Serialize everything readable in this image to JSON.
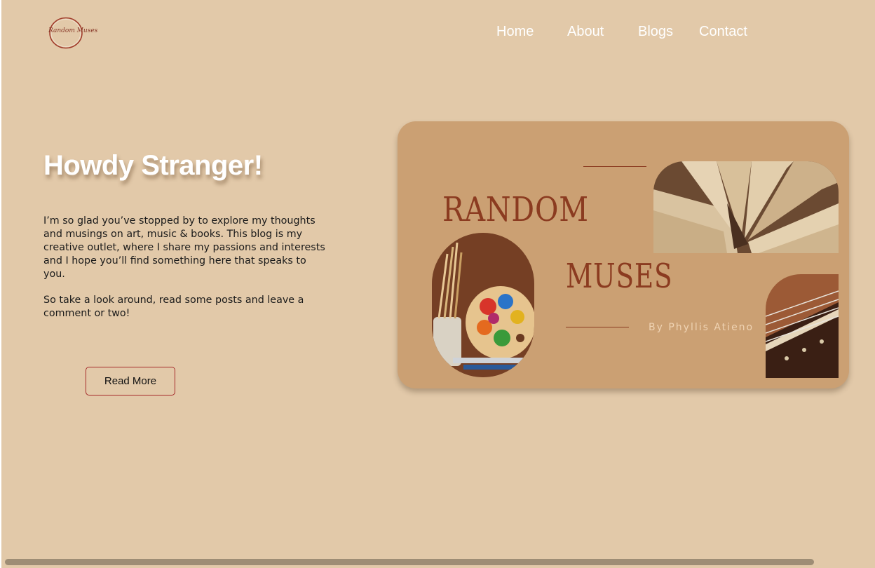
{
  "logo": {
    "text": "Random Muses"
  },
  "nav": {
    "items": [
      "Home",
      "About",
      "Blogs",
      "Contact"
    ]
  },
  "hero": {
    "title": "Howdy Stranger!",
    "paragraph_1": "I’m so glad you’ve stopped by to explore my thoughts and musings on art, music & books. This blog is my creative outlet, where I share my passions and interests and I hope you’ll find something here that speaks to you.",
    "paragraph_2": "So take a look around, read some posts and leave a comment or two!",
    "button_label": "Read More"
  },
  "banner": {
    "word_1": "RANDOM",
    "word_2": "MUSES",
    "byline": "By Phyllis Atieno"
  },
  "colors": {
    "background": "#e2c9a9",
    "banner": "#cba073",
    "accent": "#8b3b20",
    "button_border": "#a52a2a"
  },
  "icons": [
    "random-muses-logo",
    "books-photo",
    "art-palette-photo",
    "guitar-bridge-photo"
  ]
}
